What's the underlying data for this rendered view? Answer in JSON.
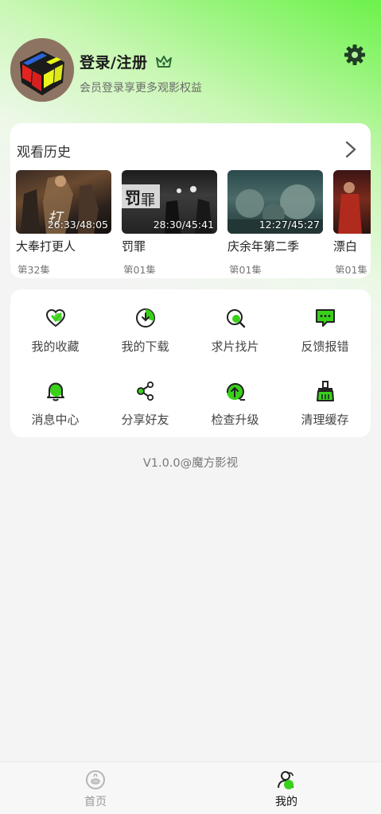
{
  "header": {
    "login_title": "登录/注册",
    "login_subtitle": "会员登录享更多观影权益"
  },
  "history": {
    "title": "观看历史",
    "items": [
      {
        "name": "大奉打更人",
        "time": "26:33/48:05",
        "episode": "第32集"
      },
      {
        "name": "罚罪",
        "time": "28:30/45:41",
        "episode": "第01集"
      },
      {
        "name": "庆余年第二季",
        "time": "12:27/45:27",
        "episode": "第01集"
      },
      {
        "name": "漂白",
        "time": "",
        "episode": "第01集"
      }
    ]
  },
  "menu": {
    "items": [
      {
        "label": "我的收藏",
        "icon": "heart-icon"
      },
      {
        "label": "我的下载",
        "icon": "download-icon"
      },
      {
        "label": "求片找片",
        "icon": "search-icon"
      },
      {
        "label": "反馈报错",
        "icon": "feedback-icon"
      },
      {
        "label": "消息中心",
        "icon": "bell-icon"
      },
      {
        "label": "分享好友",
        "icon": "share-icon"
      },
      {
        "label": "检查升级",
        "icon": "upgrade-icon"
      },
      {
        "label": "清理缓存",
        "icon": "broom-icon"
      }
    ]
  },
  "version": "V1.0.0@魔方影视",
  "nav": {
    "home": "首页",
    "mine": "我的"
  },
  "colors": {
    "accent": "#39d11a",
    "active_text": "#111111",
    "inactive_text": "#9a9a9a"
  }
}
